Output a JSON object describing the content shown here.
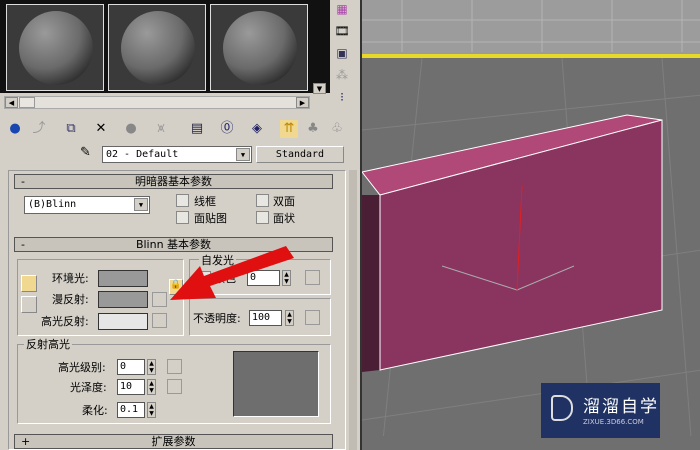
{
  "material_name": "02 - Default",
  "material_type": "Standard",
  "shader_rollout": {
    "title": "明暗器基本参数",
    "shader": "(B)Blinn",
    "checkboxes": [
      "线框",
      "双面",
      "面贴图",
      "面状"
    ]
  },
  "blinn_rollout": {
    "title": "Blinn 基本参数",
    "ambient": "环境光:",
    "diffuse": "漫反射:",
    "specular": "高光反射:",
    "self_illum_title": "自发光",
    "self_illum_label": "颜色",
    "self_illum_value": "0",
    "opacity_label": "不透明度:",
    "opacity_value": "100"
  },
  "specular_highlights": {
    "title": "反射高光",
    "level_label": "高光级别:",
    "level_value": "0",
    "gloss_label": "光泽度:",
    "gloss_value": "10",
    "soften_label": "柔化:",
    "soften_value": "0.1"
  },
  "extended_rollout": {
    "title": "扩展参数"
  },
  "watermark": {
    "name": "溜溜自学",
    "url": "ZIXUE.3D66.COM"
  },
  "colors": {
    "ambient": "#999999",
    "diffuse": "#999999",
    "specular": "#e6e6e6",
    "box": "#8a3460",
    "arrow": "#e01010"
  }
}
